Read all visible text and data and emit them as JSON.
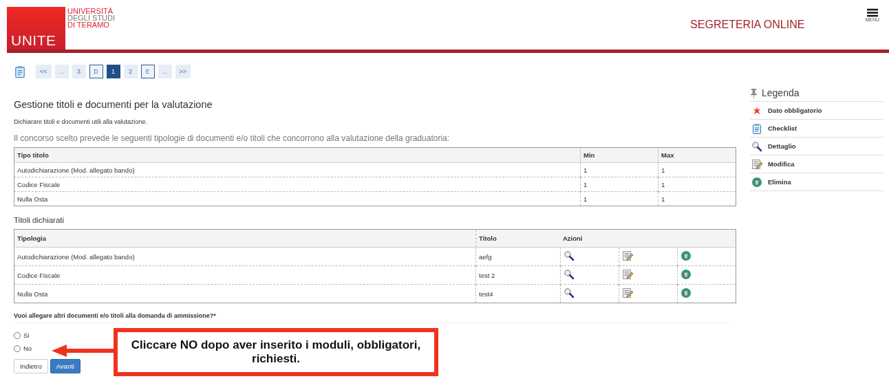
{
  "header": {
    "logo_mark": "UNITE",
    "logo_lines": [
      "UNIVERSITÀ",
      "DEGLI STUDI",
      "DI TERAMO"
    ],
    "title": "SEGRETERIA ONLINE",
    "menu_label": "MENU"
  },
  "pagination": [
    {
      "label": "<<",
      "kind": "nav",
      "selected": false
    },
    {
      "label": "...",
      "kind": "nav",
      "selected": false
    },
    {
      "label": "3",
      "kind": "page",
      "selected": false
    },
    {
      "label": "D",
      "kind": "step",
      "selected": false
    },
    {
      "label": "1",
      "kind": "page",
      "selected": true
    },
    {
      "label": "2",
      "kind": "page",
      "selected": false
    },
    {
      "label": "E",
      "kind": "step",
      "selected": false
    },
    {
      "label": "...",
      "kind": "nav",
      "selected": false
    },
    {
      "label": ">>",
      "kind": "nav",
      "selected": false
    }
  ],
  "page_title": "Gestione titoli e documenti per la valutazione",
  "description": "Dichiarare titoli e documenti utili alla valutazione.",
  "intro": "Il concorso scelto prevede le seguenti tipologie di documenti e/o titoli che concorrono alla valutazione della graduatoria:",
  "required_table": {
    "columns": [
      "Tipo titolo",
      "Min",
      "Max"
    ],
    "rows": [
      [
        "Autodichiarazione (Mod. allegato bando)",
        "1",
        "1"
      ],
      [
        "Codice Fiscale",
        "1",
        "1"
      ],
      [
        "Nulla Osta",
        "1",
        "1"
      ]
    ]
  },
  "declared_title": "Titoli dichiarati",
  "declared_table": {
    "columns": [
      "Tipologia",
      "Titolo",
      "Azioni"
    ],
    "rows": [
      {
        "tipologia": "Autodichiarazione (Mod. allegato bando)",
        "titolo": "aefg"
      },
      {
        "tipologia": "Codice Fiscale",
        "titolo": "test 2"
      },
      {
        "tipologia": "Nulla Osta",
        "titolo": "test4"
      }
    ]
  },
  "question": "Vuoi allegare altri documenti e/o titoli alla domanda di ammissione?*",
  "options": [
    {
      "label": "Si",
      "selected": false
    },
    {
      "label": "No",
      "selected": false
    }
  ],
  "buttons": [
    {
      "label": "Indietro",
      "kind": "secondary"
    },
    {
      "label": "Avanti",
      "kind": "primary"
    }
  ],
  "callout": "Cliccare NO dopo aver inserito i moduli, obbligatori, richiesti.",
  "legend": {
    "title": "Legenda",
    "items": [
      {
        "label": "Dato obbligatorio",
        "kind": "required"
      },
      {
        "label": "Checklist",
        "kind": "checklist"
      },
      {
        "label": "Dettaglio",
        "kind": "detail"
      },
      {
        "label": "Modifica",
        "kind": "edit"
      },
      {
        "label": "Elimina",
        "kind": "delete"
      }
    ]
  }
}
